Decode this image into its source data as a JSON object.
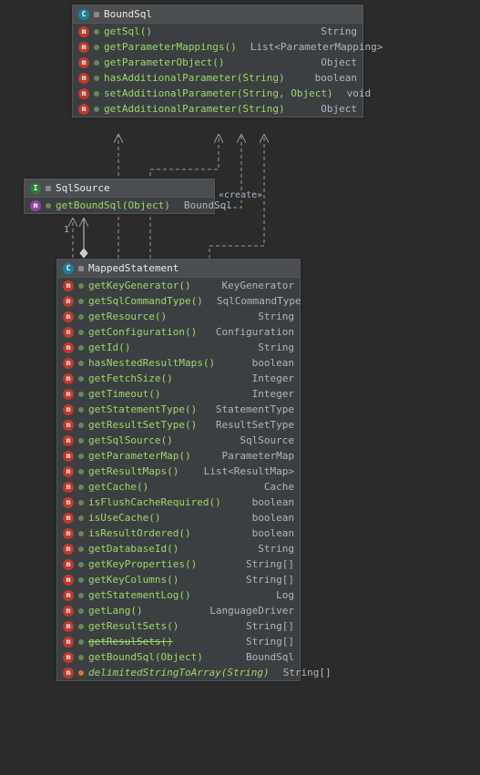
{
  "classes": {
    "BoundSql": {
      "name": "BoundSql",
      "type_icon": "C",
      "methods": [
        {
          "sig": "getSql()",
          "ret": "String",
          "kind": "m"
        },
        {
          "sig": "getParameterMappings()",
          "ret": "List<ParameterMapping>",
          "kind": "m"
        },
        {
          "sig": "getParameterObject()",
          "ret": "Object",
          "kind": "m"
        },
        {
          "sig": "hasAdditionalParameter(String)",
          "ret": "boolean",
          "kind": "m"
        },
        {
          "sig": "setAdditionalParameter(String, Object)",
          "ret": "void",
          "kind": "m"
        },
        {
          "sig": "getAdditionalParameter(String)",
          "ret": "Object",
          "kind": "m"
        }
      ]
    },
    "SqlSource": {
      "name": "SqlSource",
      "type_icon": "I",
      "methods": [
        {
          "sig": "getBoundSql(Object)",
          "ret": "BoundSql",
          "kind": "a"
        }
      ]
    },
    "MappedStatement": {
      "name": "MappedStatement",
      "type_icon": "C",
      "methods": [
        {
          "sig": "getKeyGenerator()",
          "ret": "KeyGenerator",
          "kind": "m"
        },
        {
          "sig": "getSqlCommandType()",
          "ret": "SqlCommandType",
          "kind": "m"
        },
        {
          "sig": "getResource()",
          "ret": "String",
          "kind": "m"
        },
        {
          "sig": "getConfiguration()",
          "ret": "Configuration",
          "kind": "m"
        },
        {
          "sig": "getId()",
          "ret": "String",
          "kind": "m"
        },
        {
          "sig": "hasNestedResultMaps()",
          "ret": "boolean",
          "kind": "m"
        },
        {
          "sig": "getFetchSize()",
          "ret": "Integer",
          "kind": "m"
        },
        {
          "sig": "getTimeout()",
          "ret": "Integer",
          "kind": "m"
        },
        {
          "sig": "getStatementType()",
          "ret": "StatementType",
          "kind": "m"
        },
        {
          "sig": "getResultSetType()",
          "ret": "ResultSetType",
          "kind": "m"
        },
        {
          "sig": "getSqlSource()",
          "ret": "SqlSource",
          "kind": "m"
        },
        {
          "sig": "getParameterMap()",
          "ret": "ParameterMap",
          "kind": "m"
        },
        {
          "sig": "getResultMaps()",
          "ret": "List<ResultMap>",
          "kind": "m"
        },
        {
          "sig": "getCache()",
          "ret": "Cache",
          "kind": "m"
        },
        {
          "sig": "isFlushCacheRequired()",
          "ret": "boolean",
          "kind": "m"
        },
        {
          "sig": "isUseCache()",
          "ret": "boolean",
          "kind": "m"
        },
        {
          "sig": "isResultOrdered()",
          "ret": "boolean",
          "kind": "m"
        },
        {
          "sig": "getDatabaseId()",
          "ret": "String",
          "kind": "m"
        },
        {
          "sig": "getKeyProperties()",
          "ret": "String[]",
          "kind": "m"
        },
        {
          "sig": "getKeyColumns()",
          "ret": "String[]",
          "kind": "m"
        },
        {
          "sig": "getStatementLog()",
          "ret": "Log",
          "kind": "m"
        },
        {
          "sig": "getLang()",
          "ret": "LanguageDriver",
          "kind": "m"
        },
        {
          "sig": "getResultSets()",
          "ret": "String[]",
          "kind": "m"
        },
        {
          "sig": "getResulSets()",
          "ret": "String[]",
          "kind": "m",
          "deprecated": true
        },
        {
          "sig": "getBoundSql(Object)",
          "ret": "BoundSql",
          "kind": "m"
        },
        {
          "sig": "delimitedStringToArray(String)",
          "ret": "String[]",
          "kind": "s",
          "vis": "private"
        }
      ]
    }
  },
  "labels": {
    "create_stereotype": "«create»",
    "multiplicity_one": "1"
  }
}
